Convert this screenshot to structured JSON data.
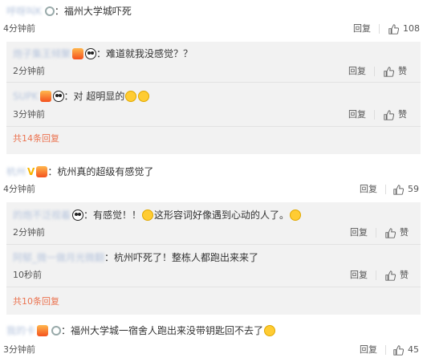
{
  "comments": [
    {
      "user": "呼呀叫K",
      "text": "：福州大学城吓死",
      "time": "4分钟前",
      "reply_label": "回复",
      "likes": "108"
    },
    {
      "user": "杭州",
      "text": "：杭州真的超级有感觉了",
      "time": "4分钟前",
      "reply_label": "回复",
      "likes": "59"
    },
    {
      "user": "我的卡",
      "text": "：福州大学城一宿舍人跑出来没带钥匙回不去了",
      "time": "3分钟前",
      "reply_label": "回复",
      "likes": "45"
    }
  ],
  "replies_1": [
    {
      "user": "炮子集王倾聚",
      "text": "：难道就我没感觉？？",
      "time": "2分钟前",
      "reply_label": "回复",
      "likes": "赞"
    },
    {
      "user": "SUPK",
      "text": "：对 超明显的",
      "time": "3分钟前",
      "reply_label": "回复",
      "likes": "赞"
    }
  ],
  "more_1": "共14条回复",
  "replies_2": [
    {
      "user": "的炮不泛视着",
      "text": "：有感觉！！",
      "text2": "这形容词好像遇到心动的人了。",
      "time": "2分钟前",
      "reply_label": "回复",
      "likes": "赞"
    },
    {
      "user": "阿郁_微一做月光微翻",
      "text": "：杭州吓死了！整栋人都跑出来来了",
      "time": "10秒前",
      "reply_label": "回复",
      "likes": "赞"
    }
  ],
  "more_2": "共10条回复",
  "colors": {
    "link": "#eb7350",
    "meta": "#555555",
    "reply_bg": "#f2f2f2"
  }
}
